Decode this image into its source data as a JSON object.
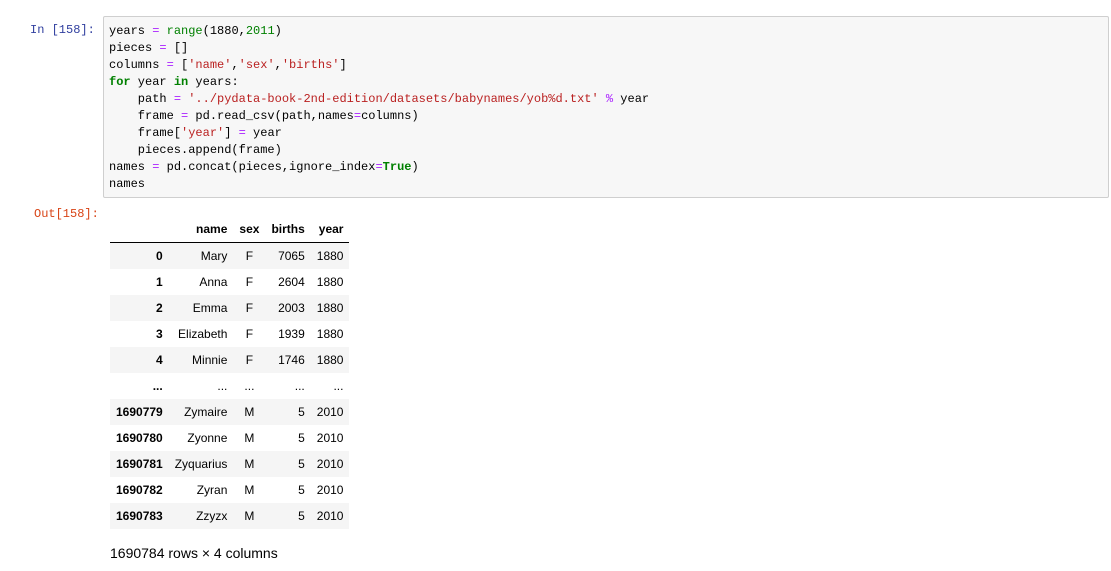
{
  "input_cell": {
    "prompt": "In  [158]:",
    "code": [
      [
        [
          "",
          "years "
        ],
        [
          "op",
          "="
        ],
        [
          "",
          " "
        ],
        [
          "bi",
          "range"
        ],
        [
          "",
          "(1880,"
        ],
        [
          "num",
          "2011"
        ],
        [
          "",
          ")"
        ]
      ],
      [
        [
          "",
          "pieces "
        ],
        [
          "op",
          "="
        ],
        [
          "",
          " []"
        ]
      ],
      [
        [
          "",
          "columns "
        ],
        [
          "op",
          "="
        ],
        [
          "",
          " ["
        ],
        [
          "str",
          "'name'"
        ],
        [
          "",
          ","
        ],
        [
          "str",
          "'sex'"
        ],
        [
          "",
          ","
        ],
        [
          "str",
          "'births'"
        ],
        [
          "",
          "]"
        ]
      ],
      [
        [
          "kw",
          "for"
        ],
        [
          "",
          " year "
        ],
        [
          "kw",
          "in"
        ],
        [
          "",
          " years:"
        ]
      ],
      [
        [
          "",
          "    path "
        ],
        [
          "op",
          "="
        ],
        [
          "",
          " "
        ],
        [
          "str",
          "'../pydata-book-2nd-edition/datasets/babynames/yob%d.txt'"
        ],
        [
          "",
          " "
        ],
        [
          "op",
          "%"
        ],
        [
          "",
          " year"
        ]
      ],
      [
        [
          "",
          "    frame "
        ],
        [
          "op",
          "="
        ],
        [
          "",
          " pd.read_csv(path,names"
        ],
        [
          "op",
          "="
        ],
        [
          "",
          "columns)"
        ]
      ],
      [
        [
          "",
          "    frame["
        ],
        [
          "str",
          "'year'"
        ],
        [
          "",
          "] "
        ],
        [
          "op",
          "="
        ],
        [
          "",
          " year"
        ]
      ],
      [
        [
          "",
          "    pieces.append(frame)"
        ]
      ],
      [
        [
          "",
          "names "
        ],
        [
          "op",
          "="
        ],
        [
          "",
          " pd.concat(pieces,ignore_index"
        ],
        [
          "op",
          "="
        ],
        [
          "kw",
          "True"
        ],
        [
          "",
          ")"
        ]
      ],
      [
        [
          "",
          "names"
        ]
      ]
    ]
  },
  "output_cell": {
    "prompt": "Out[158]:",
    "table": {
      "columns": [
        "",
        "name",
        "sex",
        "births",
        "year"
      ],
      "rows": [
        [
          "0",
          "Mary",
          "F",
          "7065",
          "1880"
        ],
        [
          "1",
          "Anna",
          "F",
          "2604",
          "1880"
        ],
        [
          "2",
          "Emma",
          "F",
          "2003",
          "1880"
        ],
        [
          "3",
          "Elizabeth",
          "F",
          "1939",
          "1880"
        ],
        [
          "4",
          "Minnie",
          "F",
          "1746",
          "1880"
        ],
        [
          "...",
          "...",
          "...",
          "...",
          "..."
        ],
        [
          "1690779",
          "Zymaire",
          "M",
          "5",
          "2010"
        ],
        [
          "1690780",
          "Zyonne",
          "M",
          "5",
          "2010"
        ],
        [
          "1690781",
          "Zyquarius",
          "M",
          "5",
          "2010"
        ],
        [
          "1690782",
          "Zyran",
          "M",
          "5",
          "2010"
        ],
        [
          "1690783",
          "Zzyzx",
          "M",
          "5",
          "2010"
        ]
      ]
    },
    "shape_text": "1690784 rows × 4 columns"
  }
}
